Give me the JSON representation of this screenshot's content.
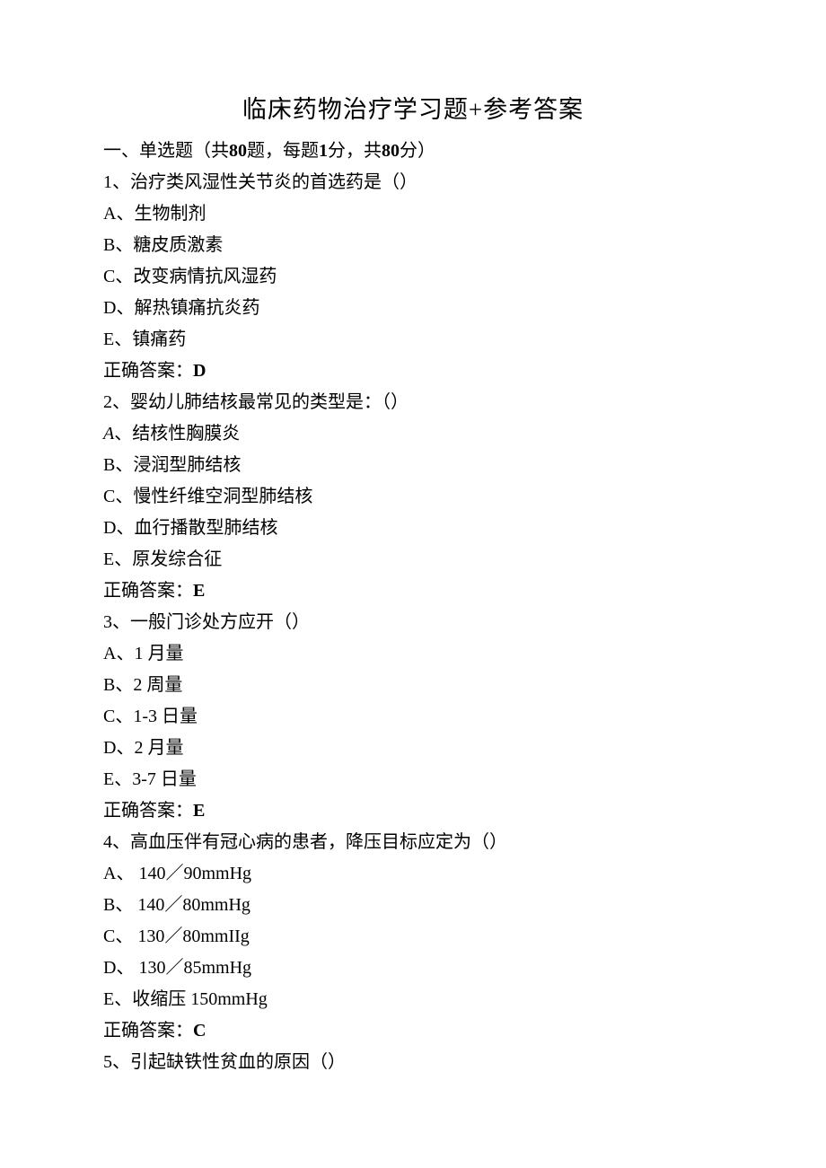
{
  "title": "临床药物治疗学习题+参考答案",
  "section_header": {
    "prefix": "一、单选题（共",
    "count": "80",
    "mid1": "题，每题",
    "per": "1",
    "mid2": "分，共",
    "total": "80",
    "suffix": "分）"
  },
  "answer_label_prefix": "正确答案：",
  "questions": [
    {
      "num": "1",
      "stem": "、治疗类风湿性关节炎的首选药是（）",
      "options": [
        {
          "letter": "A",
          "text": "、生物制剂"
        },
        {
          "letter": "B",
          "text": "、糖皮质激素"
        },
        {
          "letter": "C",
          "text": "、改变病情抗风湿药"
        },
        {
          "letter": "D",
          "text": "、解热镇痛抗炎药"
        },
        {
          "letter": "E",
          "text": "、镇痛药"
        }
      ],
      "answer": "D"
    },
    {
      "num": "2",
      "stem": "、婴幼儿肺结核最常见的类型是：（）",
      "options": [
        {
          "letter": "A",
          "italic": true,
          "text": "、结核性胸膜炎"
        },
        {
          "letter": "B",
          "text": "、浸润型肺结核"
        },
        {
          "letter": "C",
          "text": "、慢性纤维空洞型肺结核"
        },
        {
          "letter": "D",
          "text": "、血行播散型肺结核"
        },
        {
          "letter": "E",
          "text": "、原发综合征"
        }
      ],
      "answer": "E"
    },
    {
      "num": "3",
      "stem": "、一般门诊处方应开（）",
      "options": [
        {
          "letter": "A",
          "text": "、1 月量"
        },
        {
          "letter": "B",
          "text": "、2 周量"
        },
        {
          "letter": "C",
          "text": "、1-3 日量"
        },
        {
          "letter": "D",
          "text": "、2 月量"
        },
        {
          "letter": "E",
          "text": "、3-7 日量"
        }
      ],
      "answer": "E"
    },
    {
      "num": "4",
      "stem": "、高血压伴有冠心病的患者，降压目标应定为（）",
      "options": [
        {
          "letter": "A",
          "text": "、 140／90mmHg"
        },
        {
          "letter": "B",
          "text": "、 140／80mmHg"
        },
        {
          "letter": "C",
          "text": "、 130／80mmIIg"
        },
        {
          "letter": "D",
          "text": "、 130／85mmHg"
        },
        {
          "letter": "E",
          "text": "、收缩压 150mmHg"
        }
      ],
      "answer": "C"
    },
    {
      "num": "5",
      "stem": "、引起缺铁性贫血的原因（）",
      "options": [],
      "answer": null
    }
  ]
}
